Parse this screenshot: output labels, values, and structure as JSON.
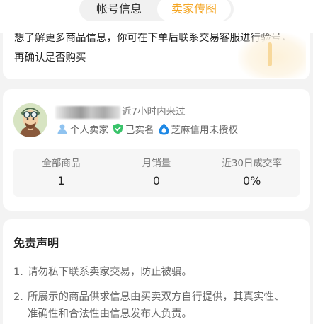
{
  "tabs": [
    {
      "label": "帐号信息",
      "active": false
    },
    {
      "label": "卖家传图",
      "active": true
    }
  ],
  "colors": {
    "accent": "#f5a623",
    "verified": "#39c36a",
    "sesame": "#1e88e5",
    "person": "#8fc3f0"
  },
  "top_notice": {
    "text": "想了解更多商品信息，你可在下单后联系交易客服进行验号，再确认是否购买"
  },
  "seller": {
    "avatar_icon": "cartoon-avatar-icon",
    "last_seen": "近7小时内来过",
    "tags": [
      {
        "icon": "person-icon",
        "label": "个人卖家"
      },
      {
        "icon": "verified-shield-icon",
        "label": "已实名"
      },
      {
        "icon": "sesame-credit-icon",
        "label": "芝麻信用未授权"
      }
    ],
    "stats": [
      {
        "label": "全部商品",
        "value": "1"
      },
      {
        "label": "月销量",
        "value": "0"
      },
      {
        "label": "近30日成交率",
        "value": "0%"
      }
    ]
  },
  "disclaimer": {
    "title": "免责声明",
    "items": [
      {
        "num": "1.",
        "text": "请勿私下联系卖家交易，防止被骗。"
      },
      {
        "num": "2.",
        "text": "所展示的商品供求信息由买卖双方自行提供，其真实性、准确性和合法性由信息发布人负责。"
      }
    ]
  }
}
